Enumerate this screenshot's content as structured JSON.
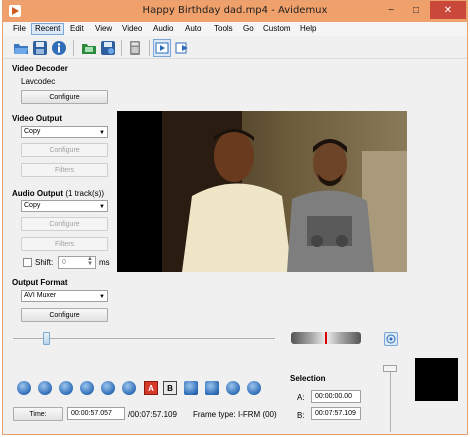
{
  "window": {
    "title": "Happy Birthday dad.mp4 - Avidemux"
  },
  "titlebar_buttons": {
    "minimize": "−",
    "maximize": "□",
    "close": "✕"
  },
  "menu": [
    "File",
    "Recent",
    "Edit",
    "View",
    "Video",
    "Audio",
    "Auto",
    "Tools",
    "Go",
    "Custom",
    "Help"
  ],
  "toolbar_icons": [
    "open-icon",
    "save-icon",
    "info-icon",
    "open-video-icon",
    "save-video-icon",
    "calculator-icon",
    "preview-input-icon",
    "preview-output-icon"
  ],
  "video_decoder": {
    "title": "Video Decoder",
    "codec": "Lavcodec",
    "configure": "Configure"
  },
  "video_output": {
    "title": "Video Output",
    "value": "Copy",
    "configure": "Configure",
    "filters": "Filters"
  },
  "audio_output": {
    "title": "Audio Output",
    "tracks": "(1 track(s))",
    "value": "Copy",
    "configure": "Configure",
    "filters": "Filters",
    "shift_label": "Shift:",
    "shift_value": "0",
    "shift_unit": "ms"
  },
  "output_format": {
    "title": "Output Format",
    "value": "AVI Muxer",
    "configure": "Configure"
  },
  "navigation": {
    "ab_a": "A",
    "ab_b": "B"
  },
  "status": {
    "time_button": "Time:",
    "current_time": "00:00:57.057",
    "total_time": "/00:07:57.109",
    "frame_type_label": "Frame type:",
    "frame_type_value": "I-FRM (00)"
  },
  "selection": {
    "title": "Selection",
    "a_label": "A:",
    "a_value": "00:00:00.00",
    "b_label": "B:",
    "b_value": "00:07:57.109"
  },
  "colors": {
    "titlebar": "#f0a06a",
    "close": "#c9483a",
    "accent": "#2f6db8"
  }
}
